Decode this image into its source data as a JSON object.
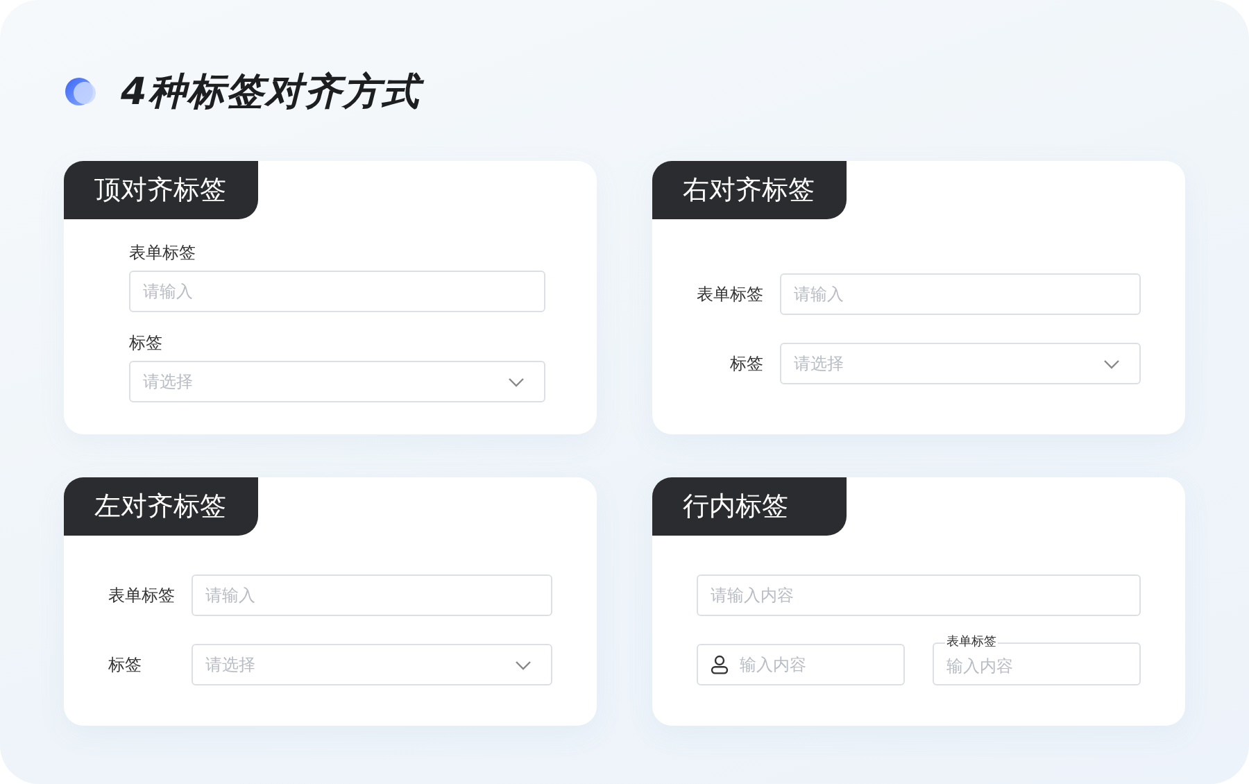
{
  "title": "4种标签对齐方式",
  "panels": [
    {
      "kind": "top",
      "title": "顶对齐标签",
      "fields": [
        {
          "kind": "input",
          "label": "表单标签",
          "placeholder": "请输入"
        },
        {
          "kind": "select",
          "label": "标签",
          "placeholder": "请选择"
        }
      ]
    },
    {
      "kind": "right",
      "title": "右对齐标签",
      "fields": [
        {
          "kind": "input",
          "label": "表单标签",
          "placeholder": "请输入"
        },
        {
          "kind": "select",
          "label": "标签",
          "placeholder": "请选择"
        }
      ]
    },
    {
      "kind": "left",
      "title": "左对齐标签",
      "fields": [
        {
          "kind": "input",
          "label": "表单标签",
          "placeholder": "请输入"
        },
        {
          "kind": "select",
          "label": "标签",
          "placeholder": "请选择"
        }
      ]
    },
    {
      "kind": "inline",
      "title": "行内标签",
      "fields": [
        {
          "kind": "input",
          "placeholder": "请输入内容"
        },
        {
          "kind": "icon-input",
          "placeholder": "输入内容"
        },
        {
          "kind": "float",
          "label": "表单标签",
          "placeholder": "输入内容"
        }
      ]
    }
  ]
}
